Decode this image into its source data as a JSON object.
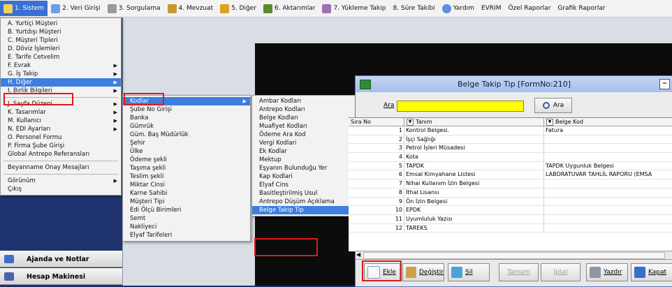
{
  "menubar": {
    "items": [
      {
        "label": "1. Sistem",
        "icon": "system-icon",
        "color": "#ffffff"
      },
      {
        "label": "2. Veri Girişi",
        "icon": "data-entry-icon",
        "color": "#6aa0e8"
      },
      {
        "label": "3. Sorgulama",
        "icon": "query-icon",
        "color": "#9a9a9a"
      },
      {
        "label": "4. Mevzuat",
        "icon": "legislation-icon",
        "color": "#c79a2b"
      },
      {
        "label": "5. Diğer",
        "icon": "other-icon",
        "color": "#e0a020"
      },
      {
        "label": "6. Aktarımlar",
        "icon": "transfer-icon",
        "color": "#5a8a2a"
      },
      {
        "label": "7. Yükleme Takip",
        "icon": "upload-track-icon",
        "color": "#a070b0"
      },
      {
        "label": "8. Süre Takibi",
        "icon": "",
        "color": ""
      },
      {
        "label": "Yardım",
        "icon": "help-icon",
        "color": "#5b8fe0"
      },
      {
        "label": "EVRIM",
        "icon": "",
        "color": ""
      },
      {
        "label": "Özel Raporlar",
        "icon": "",
        "color": ""
      },
      {
        "label": "Grafik Raporlar",
        "icon": "",
        "color": ""
      }
    ]
  },
  "menu_sistem": {
    "group1": [
      {
        "label": "A. Yurtiçi Müşteri",
        "sub": false
      },
      {
        "label": "B. Yurtdışı Müşteri",
        "sub": false
      },
      {
        "label": "C. Müşteri Tipleri",
        "sub": false
      },
      {
        "label": "D. Döviz İşlemleri",
        "sub": false
      },
      {
        "label": "E. Tarife Cetvelim",
        "sub": false
      },
      {
        "label": "F. Evrak",
        "sub": true
      },
      {
        "label": "G. İş Takip",
        "sub": true
      },
      {
        "label": "H. Diğer",
        "sub": true
      },
      {
        "label": "I. Birlik Bilgileri",
        "sub": true
      }
    ],
    "group2": [
      {
        "label": "J. Sayfa Düzeni",
        "sub": true
      },
      {
        "label": "K. Tasarımlar",
        "sub": true
      },
      {
        "label": "M. Kullanıcı",
        "sub": true
      },
      {
        "label": "N. EDI Ayarları",
        "sub": true
      },
      {
        "label": "O. Personel Formu",
        "sub": false
      },
      {
        "label": "P. Firma Şube Girişi",
        "sub": false
      },
      {
        "label": "Global Antrepo Referansları",
        "sub": false
      }
    ],
    "group3": [
      {
        "label": "Beyanname Onay Mesajları",
        "sub": false
      }
    ],
    "group4": [
      {
        "label": "Görünüm",
        "sub": true
      },
      {
        "label": "Çıkış",
        "sub": false
      }
    ]
  },
  "menu_diger": {
    "items": [
      "Kodlar",
      "Şube No Girişi",
      "Banka",
      "Gümrük",
      "Güm. Baş Müdürlük",
      "Şehir",
      "Ülke",
      "Ödeme şekli",
      "Taşıma şekli",
      "Teslim şekli",
      "Miktar Cinsi",
      "Karne Sahibi",
      "Müşteri Tipi",
      "Edi Ölçü Birimleri",
      "Semt",
      "Nakliyeci",
      "Elyaf Tarifeleri"
    ]
  },
  "menu_kodlar": {
    "items": [
      "Ambar Kodları",
      "Antrepo Kodları",
      "Belge Kodları",
      "Muafiyet Kodları",
      "Ödeme Ara Kod",
      "Vergi Kodlari",
      "Ek Kodlar",
      "Mektup",
      "Eşyanın Bulunduğu Yer",
      "Kap Kodlari",
      "Elyaf Cins",
      "Basitleştirilmiş Usul",
      "Antrepo Düşüm Açıklama",
      "Belge Takip Tip"
    ]
  },
  "sidebar": {
    "buttons": [
      {
        "label": "Ajanda ve Notlar",
        "icon": "agenda-icon"
      },
      {
        "label": "Hesap Makinesi",
        "icon": "calculator-icon"
      }
    ]
  },
  "window": {
    "title": "Belge Takip Tip [FormNo:210]",
    "search_label": "Ara",
    "search_value": "",
    "search_button": "Ara",
    "columns": [
      "Sıra No",
      "Tanım",
      "Belge Kod"
    ],
    "rows": [
      [
        "1",
        "Kontrol Belgesi.",
        "Fatura"
      ],
      [
        "2",
        "İşçi Sağlığı",
        ""
      ],
      [
        "3",
        "Petrol İşleri Müsadesi",
        ""
      ],
      [
        "4",
        "Kota",
        ""
      ],
      [
        "5",
        "TAPDK",
        "TAPDK Uygunluk Belgesi"
      ],
      [
        "6",
        "Emsal Kimyahane Listesi",
        "LABORATUVAR TAHLİL RAPORU (EMSA"
      ],
      [
        "7",
        "Nihai Kullanım İzin Belgesi",
        ""
      ],
      [
        "8",
        "İthal Lisansı",
        ""
      ],
      [
        "9",
        "Ön İzin Belgesi",
        ""
      ],
      [
        "10",
        "EPDK",
        ""
      ],
      [
        "11",
        "Uyumluluk Yazısı",
        ""
      ],
      [
        "12",
        "TAREKS",
        ""
      ]
    ],
    "toolbar": [
      {
        "label": "Ekle",
        "icon": "add-icon",
        "enabled": true
      },
      {
        "label": "Değiştir",
        "icon": "edit-icon",
        "enabled": true
      },
      {
        "label": "Sil",
        "icon": "delete-icon",
        "enabled": true
      },
      {
        "label": "Tamam",
        "icon": "",
        "enabled": false
      },
      {
        "label": "İptal",
        "icon": "",
        "enabled": false
      },
      {
        "label": "Yazdır",
        "icon": "print-icon",
        "enabled": true
      },
      {
        "label": "Kapat",
        "icon": "close-door-icon",
        "enabled": true
      }
    ]
  },
  "colors": {
    "highlight": "#3c7fe0",
    "annotation_box": "#e01a1a",
    "search_bg": "#ffff00"
  }
}
